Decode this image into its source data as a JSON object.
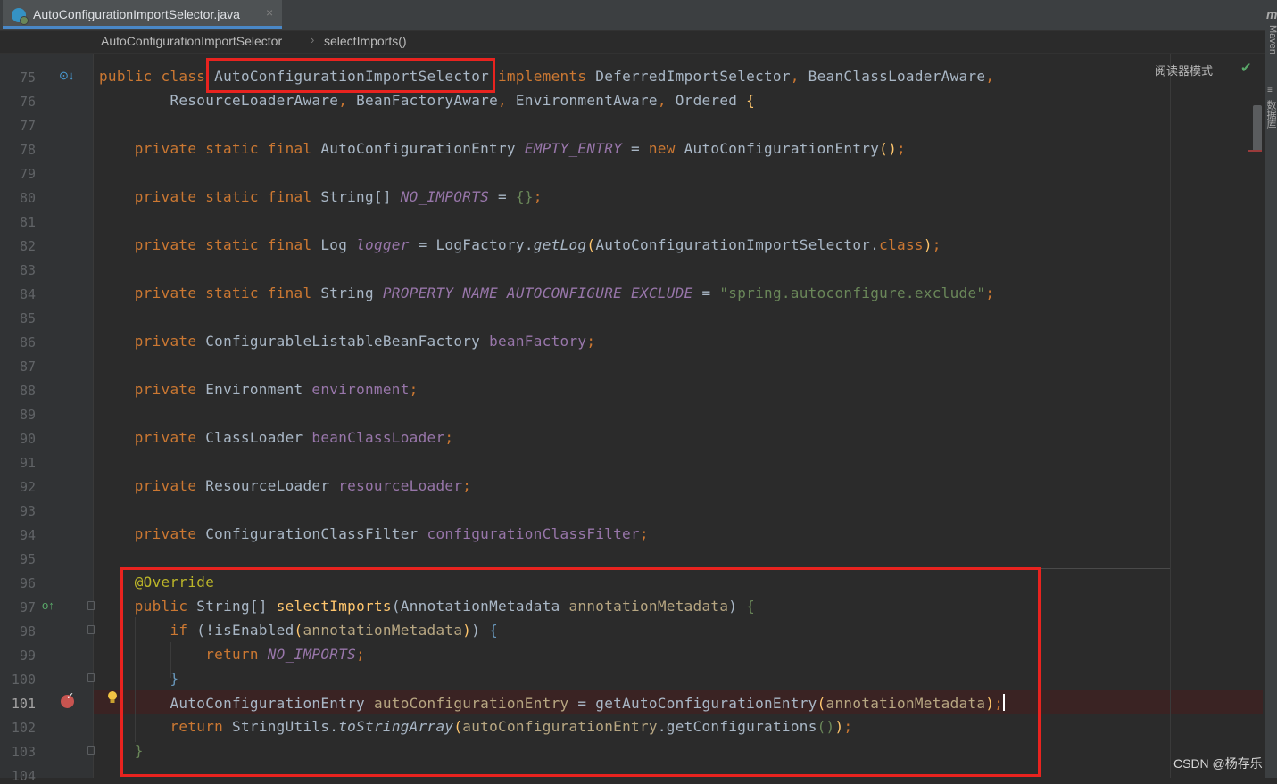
{
  "tab": {
    "title": "AutoConfigurationImportSelector.java",
    "close": "×"
  },
  "breadcrumb": {
    "class_name": "AutoConfigurationImportSelector",
    "sep": "›",
    "method": "selectImports()"
  },
  "right_tools": {
    "maven": "Maven",
    "database": "数据库"
  },
  "reader_mode": "阅读器模式",
  "watermark": "CSDN @杨存乐",
  "line_numbers": [
    "75",
    "76",
    "77",
    "78",
    "79",
    "80",
    "81",
    "82",
    "83",
    "84",
    "85",
    "86",
    "87",
    "88",
    "89",
    "90",
    "91",
    "92",
    "93",
    "94",
    "95",
    "96",
    "97",
    "98",
    "99",
    "100",
    "101",
    "102",
    "103",
    "104"
  ],
  "code": {
    "l75": {
      "kw1": "public class",
      "cls": "AutoConfigurationImportSelector",
      "kw2": "implements",
      "t1": "DeferredImportSelector",
      "t2": "BeanClassLoaderAware"
    },
    "l76": {
      "t1": "ResourceLoaderAware",
      "t2": "BeanFactoryAware",
      "t3": "EnvironmentAware",
      "t4": "Ordered"
    },
    "l78": {
      "kw": "private static final",
      "type": "AutoConfigurationEntry",
      "name": "EMPTY_ENTRY",
      "kw2": "new",
      "call": "AutoConfigurationEntry"
    },
    "l80": {
      "kw": "private static final",
      "type": "String[]",
      "name": "NO_IMPORTS"
    },
    "l82": {
      "kw": "private static final",
      "type": "Log",
      "name": "logger",
      "call1": "LogFactory",
      "call2": "getLog",
      "arg": "AutoConfigurationImportSelector",
      "kw2": "class"
    },
    "l84": {
      "kw": "private static final",
      "type": "String",
      "name": "PROPERTY_NAME_AUTOCONFIGURE_EXCLUDE",
      "value": "\"spring.autoconfigure.exclude\""
    },
    "l86": {
      "kw": "private",
      "type": "ConfigurableListableBeanFactory",
      "name": "beanFactory"
    },
    "l88": {
      "kw": "private",
      "type": "Environment",
      "name": "environment"
    },
    "l90": {
      "kw": "private",
      "type": "ClassLoader",
      "name": "beanClassLoader"
    },
    "l92": {
      "kw": "private",
      "type": "ResourceLoader",
      "name": "resourceLoader"
    },
    "l94": {
      "kw": "private",
      "type": "ConfigurationClassFilter",
      "name": "configurationClassFilter"
    },
    "l96": {
      "ann": "@Override"
    },
    "l97": {
      "kw": "public",
      "type": "String[]",
      "fn": "selectImports",
      "ptype": "AnnotationMetadata",
      "pname": "annotationMetadata"
    },
    "l98": {
      "kw": "if",
      "call": "!isEnabled",
      "arg": "annotationMetadata"
    },
    "l99": {
      "kw": "return",
      "name": "NO_IMPORTS"
    },
    "l101": {
      "type": "AutoConfigurationEntry",
      "var": "autoConfigurationEntry",
      "call": "getAutoConfigurationEntry",
      "arg": "annotationMetadata"
    },
    "l102": {
      "kw": "return",
      "cls": "StringUtils",
      "call": "toStringArray",
      "var": "autoConfigurationEntry",
      "call2": "getConfigurations"
    }
  }
}
